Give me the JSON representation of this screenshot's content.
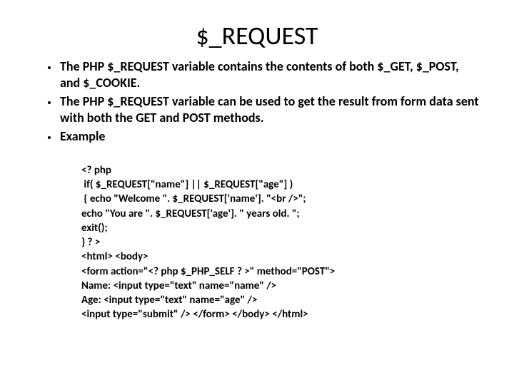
{
  "title": "$_REQUEST",
  "bullets": [
    "The PHP $_REQUEST variable contains the contents of both $_GET, $_POST, and $_COOKIE.",
    "The PHP $_REQUEST variable can be used to get the result from form data sent with both the GET and POST methods.",
    "Example"
  ],
  "code_lines": [
    "<? php",
    " if( $_REQUEST[\"name\"] || $_REQUEST[\"age\"] )",
    " { echo \"Welcome \". $_REQUEST['name']. \"<br />\";",
    "echo \"You are \". $_REQUEST['age']. \" years old. \";",
    "exit();",
    "} ? >",
    "<html> <body>",
    "<form action=\"<? php $_PHP_SELF ? >\" method=\"POST\">",
    "Name: <input type=\"text\" name=\"name\" />",
    "Age: <input type=\"text\" name=\"age\" />",
    "<input type=\"submit\" /> </form> </body> </html>"
  ]
}
